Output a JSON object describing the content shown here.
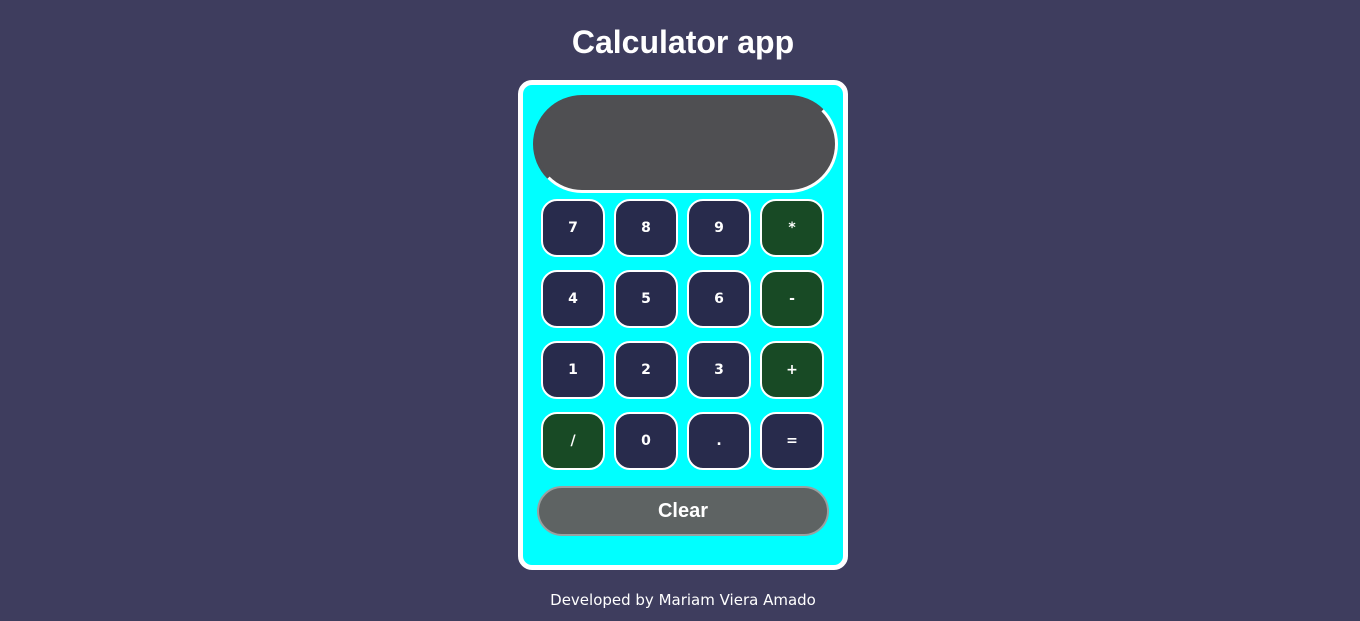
{
  "title": "Calculator app",
  "display": {
    "value": ""
  },
  "keys": {
    "k7": "7",
    "k8": "8",
    "k9": "9",
    "multiply": "*",
    "k4": "4",
    "k5": "5",
    "k6": "6",
    "subtract": "-",
    "k1": "1",
    "k2": "2",
    "k3": "3",
    "add": "+",
    "divide": "/",
    "k0": "0",
    "decimal": ".",
    "equals": "="
  },
  "clear_label": "Clear",
  "footer": "Developed by Mariam Viera Amado",
  "colors": {
    "background": "#3e3d5e",
    "calculator_body": "#00ffff",
    "display": "#4f4f52",
    "number_key": "#282b4c",
    "operator_key": "#184a25",
    "clear_button": "#5e6363"
  }
}
